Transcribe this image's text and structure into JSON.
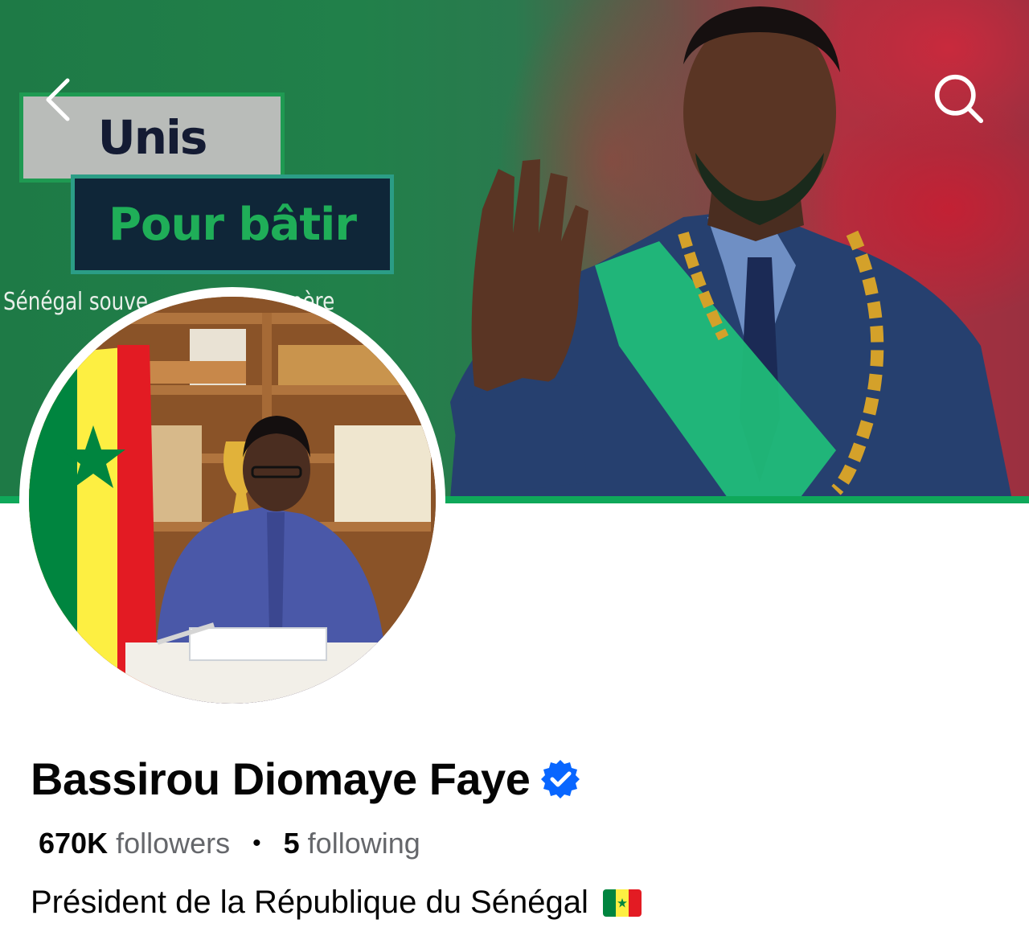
{
  "cover": {
    "banner_line1": "Unis",
    "banner_line2": "Pour bâtir",
    "caption": "Sénégal souve",
    "caption_tail": "spère",
    "accent_green": "#1fae58",
    "bottom_line_color": "#0fa85a"
  },
  "nav": {
    "back_icon": "chevron-left-icon",
    "search_icon": "search-icon"
  },
  "profile": {
    "name": "Bassirou Diomaye Faye",
    "verified": true,
    "verified_color": "#0866ff",
    "followers_count": "670K",
    "followers_label": "followers",
    "separator": "•",
    "following_count": "5",
    "following_label": "following",
    "bio": "Président de la République du Sénégal",
    "bio_emoji": "senegal-flag"
  },
  "flag_colors": [
    "#00853f",
    "#fdef42",
    "#e31b23"
  ]
}
